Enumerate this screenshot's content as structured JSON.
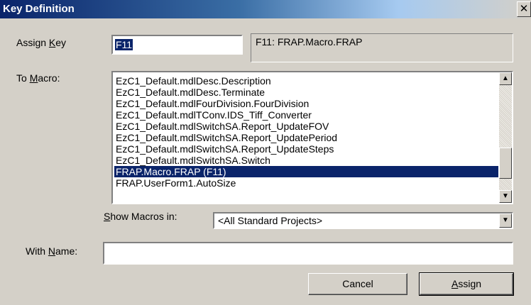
{
  "window": {
    "title": "Key Definition",
    "close_glyph": "✕"
  },
  "assign_key": {
    "label_pre": "Assign ",
    "label_key": "K",
    "label_post": "ey",
    "value": "F11",
    "description": "F11: FRAP.Macro.FRAP"
  },
  "to_macro": {
    "label_pre": "To ",
    "label_key": "M",
    "label_post": "acro:",
    "items": [
      "EzC1_Default.mdlDesc.Description",
      "EzC1_Default.mdlDesc.Terminate",
      "EzC1_Default.mdlFourDivision.FourDivision",
      "EzC1_Default.mdlTConv.IDS_Tiff_Converter",
      "EzC1_Default.mdlSwitchSA.Report_UpdateFOV",
      "EzC1_Default.mdlSwitchSA.Report_UpdatePeriod",
      "EzC1_Default.mdlSwitchSA.Report_UpdateSteps",
      "EzC1_Default.mdlSwitchSA.Switch",
      "FRAP.Macro.FRAP (F11)",
      "FRAP.UserForm1.AutoSize"
    ],
    "selected_index": 8,
    "scroll_up_icon": "up-arrow-icon",
    "scroll_down_icon": "down-arrow-icon"
  },
  "show_macros": {
    "label_key": "S",
    "label_post": "how Macros in:",
    "selected": "<All Standard Projects>",
    "dropdown_icon": "down-arrow-icon"
  },
  "with_name": {
    "label_pre": "With ",
    "label_key": "N",
    "label_post": "ame:",
    "value": ""
  },
  "buttons": {
    "cancel": "Cancel",
    "assign_key": "A",
    "assign_post": "ssign"
  },
  "colors": {
    "titlebar": "#0a246a",
    "selection": "#0a246a",
    "face": "#d4d0c8"
  }
}
